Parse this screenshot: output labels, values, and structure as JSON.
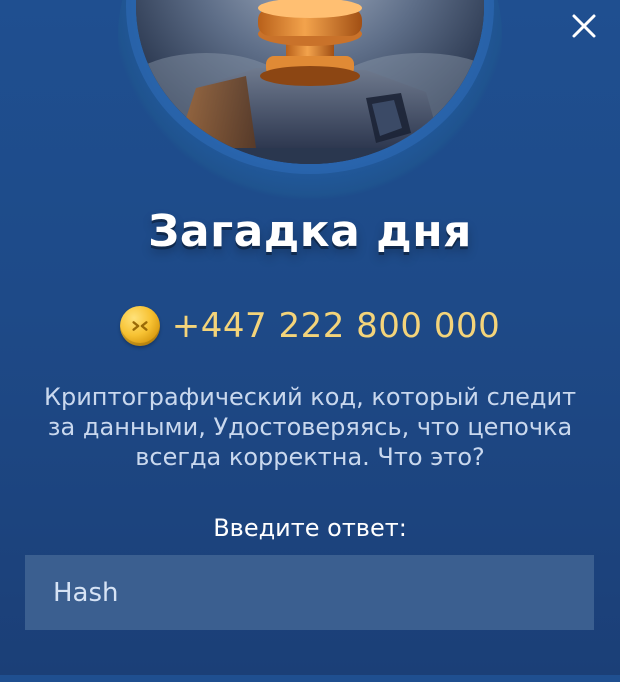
{
  "modal": {
    "title": "Загадка дня",
    "reward": {
      "icon": "coin-icon",
      "value": "+447 222 800 000",
      "color": "#f4d47a"
    },
    "question": "Криптографический код, который следит за данными, Удостоверяясь, что цепочка всегда корректна. Что это?",
    "answer_label": "Введите ответ:",
    "answer_value": "Hash",
    "close_icon": "close-icon",
    "hero_image": "stone-button-illustration"
  }
}
